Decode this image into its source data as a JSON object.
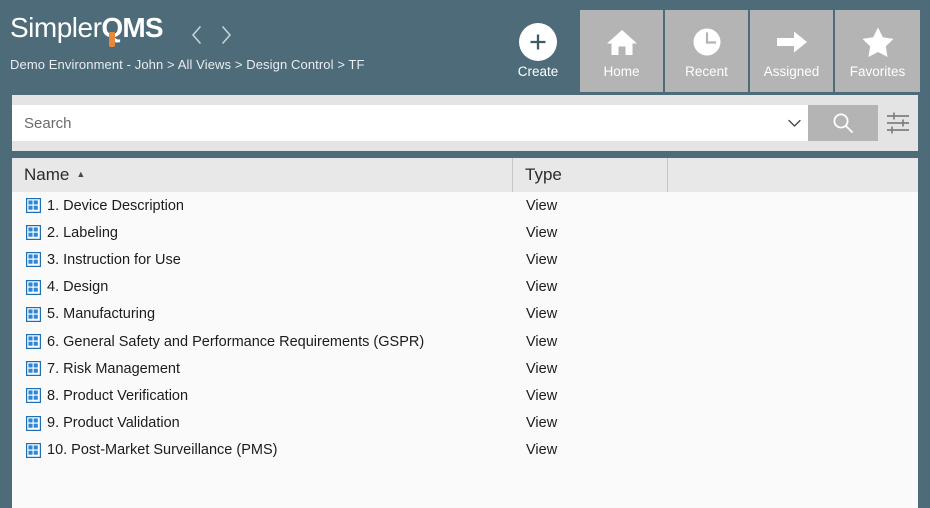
{
  "brand": {
    "name_light": "Simpler",
    "name_bold_q": "Q",
    "name_bold_rest": "MS",
    "accent_color": "#e8883a",
    "header_color": "#4d6b78"
  },
  "nav": {
    "back_icon": "chevron-left-icon",
    "forward_icon": "chevron-right-icon"
  },
  "breadcrumb": {
    "full": "Demo Environment - John > All Views > Design Control > TF",
    "parts": [
      "Demo Environment - John",
      "All Views",
      "Design Control",
      "TF"
    ]
  },
  "topnav": {
    "items": [
      {
        "label": "Create",
        "icon": "plus-circle-icon",
        "style": "plain"
      },
      {
        "label": "Home",
        "icon": "home-icon",
        "style": "tile"
      },
      {
        "label": "Recent",
        "icon": "clock-icon",
        "style": "tile"
      },
      {
        "label": "Assigned",
        "icon": "arrow-right-icon",
        "style": "tile"
      },
      {
        "label": "Favorites",
        "icon": "star-icon",
        "style": "tile"
      }
    ]
  },
  "search": {
    "placeholder": "Search",
    "value": "",
    "dropdown_icon": "chevron-down-icon",
    "button_icon": "magnifier-icon",
    "filter_icon": "filter-sliders-icon"
  },
  "table": {
    "columns": [
      {
        "key": "name",
        "label": "Name",
        "sort": "asc",
        "sort_glyph": "▲"
      },
      {
        "key": "type",
        "label": "Type",
        "sort": "none"
      },
      {
        "key": "rest",
        "label": "",
        "sort": "none"
      }
    ],
    "row_icon": "grid-view-icon",
    "rows": [
      {
        "name": "1. Device Description",
        "type": "View"
      },
      {
        "name": "2. Labeling",
        "type": "View"
      },
      {
        "name": "3. Instruction for Use",
        "type": "View"
      },
      {
        "name": "4. Design",
        "type": "View"
      },
      {
        "name": "5. Manufacturing",
        "type": "View"
      },
      {
        "name": "6. General Safety and Performance Requirements (GSPR)",
        "type": "View"
      },
      {
        "name": "7. Risk Management",
        "type": "View"
      },
      {
        "name": "8. Product Verification",
        "type": "View"
      },
      {
        "name": "9. Product Validation",
        "type": "View"
      },
      {
        "name": "10. Post-Market Surveillance (PMS)",
        "type": "View"
      }
    ]
  }
}
